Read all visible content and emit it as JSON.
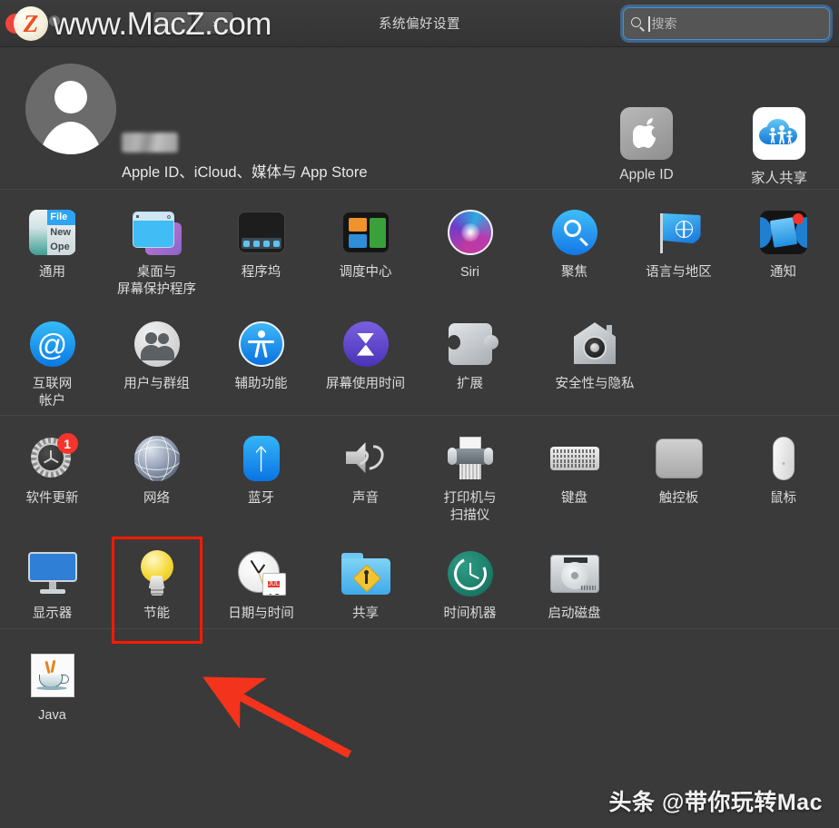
{
  "window": {
    "title": "系统偏好设置",
    "traffic_lights": [
      "close",
      "minimize",
      "zoom"
    ],
    "nav_back_icon": "chevron-left-icon",
    "nav_forward_icon": "chevron-right-icon"
  },
  "search": {
    "placeholder": "搜索",
    "value": "",
    "icon": "search-icon",
    "focused": true,
    "focus_ring_color": "#4e8ec9"
  },
  "watermark_top": {
    "text": "www.MacZ.com",
    "badge_letter": "Z"
  },
  "watermark_bottom": {
    "text": "头条 @带你玩转Mac"
  },
  "account": {
    "name_redacted": true,
    "subtitle": "Apple ID、iCloud、媒体与 App Store",
    "avatar_icon": "person-avatar-icon",
    "tiles": [
      {
        "label": "Apple ID",
        "icon": "apple-logo-icon"
      },
      {
        "label": "家人共享",
        "icon": "family-sharing-cloud-icon"
      }
    ]
  },
  "sections": [
    {
      "name": "personal",
      "rows": [
        [
          {
            "label": "通用",
            "icon": "general-icon"
          },
          {
            "label": "桌面与\n屏幕保护程序",
            "icon": "desktop-screensaver-icon"
          },
          {
            "label": "程序坞",
            "icon": "dock-icon"
          },
          {
            "label": "调度中心",
            "icon": "mission-control-icon"
          },
          {
            "label": "Siri",
            "icon": "siri-icon"
          },
          {
            "label": "聚焦",
            "icon": "spotlight-icon"
          },
          {
            "label": "语言与地区",
            "icon": "language-region-icon"
          },
          {
            "label": "通知",
            "icon": "notifications-icon",
            "badge": ""
          }
        ],
        [
          {
            "label": "互联网\n帐户",
            "icon": "internet-accounts-icon"
          },
          {
            "label": "用户与群组",
            "icon": "users-groups-icon"
          },
          {
            "label": "辅助功能",
            "icon": "accessibility-icon"
          },
          {
            "label": "屏幕使用时间",
            "icon": "screen-time-icon"
          },
          {
            "label": "扩展",
            "icon": "extensions-icon"
          },
          {
            "label": "安全性与隐私",
            "icon": "security-privacy-icon"
          }
        ]
      ]
    },
    {
      "name": "hardware",
      "rows": [
        [
          {
            "label": "软件更新",
            "icon": "software-update-icon",
            "badge": "1"
          },
          {
            "label": "网络",
            "icon": "network-icon"
          },
          {
            "label": "蓝牙",
            "icon": "bluetooth-icon"
          },
          {
            "label": "声音",
            "icon": "sound-icon"
          },
          {
            "label": "打印机与\n扫描仪",
            "icon": "printers-scanners-icon"
          },
          {
            "label": "键盘",
            "icon": "keyboard-icon"
          },
          {
            "label": "触控板",
            "icon": "trackpad-icon"
          },
          {
            "label": "鼠标",
            "icon": "mouse-icon"
          }
        ],
        [
          {
            "label": "显示器",
            "icon": "displays-icon"
          },
          {
            "label": "节能",
            "icon": "energy-saver-icon",
            "selected": true
          },
          {
            "label": "日期与时间",
            "icon": "date-time-icon",
            "clock_month": "JUL",
            "clock_day": "18"
          },
          {
            "label": "共享",
            "icon": "sharing-icon"
          },
          {
            "label": "时间机器",
            "icon": "time-machine-icon"
          },
          {
            "label": "启动磁盘",
            "icon": "startup-disk-icon"
          }
        ]
      ]
    },
    {
      "name": "other",
      "rows": [
        [
          {
            "label": "Java",
            "icon": "java-icon"
          }
        ]
      ]
    }
  ],
  "annotation": {
    "highlight_color": "#ff1a00",
    "highlight_target": "节能",
    "arrow_color": "#f4331c"
  }
}
